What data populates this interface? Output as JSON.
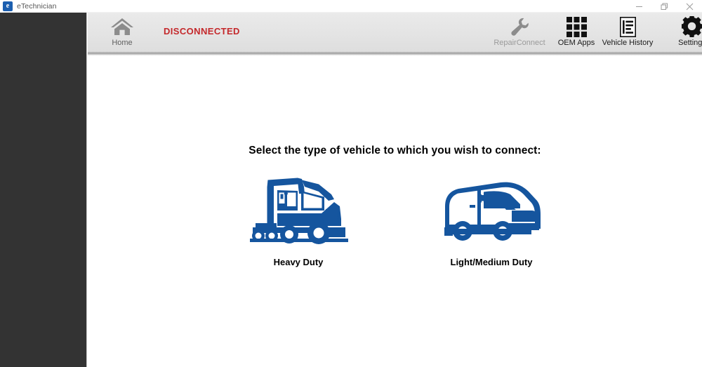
{
  "window": {
    "app_icon": "etechnician-app-icon",
    "title": "eTechnician",
    "controls": {
      "minimize": "minimize-icon",
      "maximize": "restore-icon",
      "close": "close-icon"
    }
  },
  "toolbar": {
    "status": "DISCONNECTED",
    "status_color": "#c4282b",
    "items": [
      {
        "id": "home",
        "label": "Home",
        "icon": "home-icon",
        "enabled": true
      },
      {
        "id": "repairconnect",
        "label": "RepairConnect",
        "icon": "wrench-icon",
        "enabled": false
      },
      {
        "id": "oemapps",
        "label": "OEM Apps",
        "icon": "grid-apps-icon",
        "enabled": true
      },
      {
        "id": "vehiclehistory",
        "label": "Vehicle History",
        "icon": "document-icon",
        "enabled": true
      },
      {
        "id": "settings",
        "label": "Settings",
        "icon": "gear-icon",
        "enabled": true
      }
    ]
  },
  "main": {
    "heading": "Select the type of vehicle to which you wish to connect:",
    "accent_color": "#15559e",
    "choices": [
      {
        "id": "heavy-duty",
        "label": "Heavy Duty",
        "icon": "semi-truck-illustration"
      },
      {
        "id": "light-medium-duty",
        "label": "Light/Medium Duty",
        "icon": "cargo-van-illustration"
      }
    ]
  }
}
